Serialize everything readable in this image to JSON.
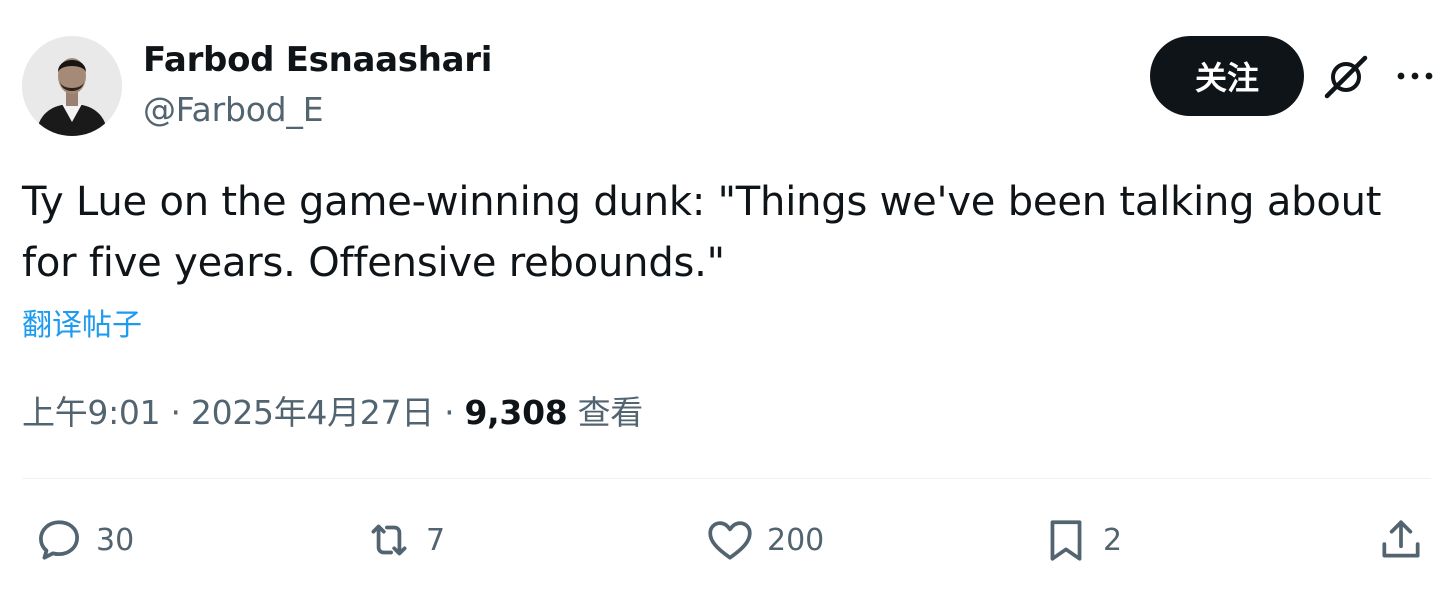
{
  "author": {
    "display_name": "Farbod Esnaashari",
    "handle": "@Farbod_E",
    "avatar": "person-portrait-icon"
  },
  "header": {
    "follow_label": "关注",
    "grok_icon": "grok-icon",
    "more_icon": "more-icon"
  },
  "tweet": {
    "text": "Ty Lue on the game-winning dunk: \"Things we've been talking about for five years. Offensive rebounds.\"",
    "translate_label": "翻译帖子",
    "time": "上午9:01",
    "separator": "·",
    "date": "2025年4月27日",
    "views_count": "9,308",
    "views_label": "查看"
  },
  "actions": {
    "reply": {
      "icon": "reply-icon",
      "count": "30"
    },
    "retweet": {
      "icon": "retweet-icon",
      "count": "7"
    },
    "like": {
      "icon": "heart-icon",
      "count": "200"
    },
    "bookmark": {
      "icon": "bookmark-icon",
      "count": "2"
    },
    "share": {
      "icon": "share-icon"
    }
  },
  "colors": {
    "text_primary": "#0f1419",
    "text_secondary": "#536471",
    "link": "#1d9bf0",
    "button_bg": "#0f1419",
    "divider": "#eff3f4"
  }
}
